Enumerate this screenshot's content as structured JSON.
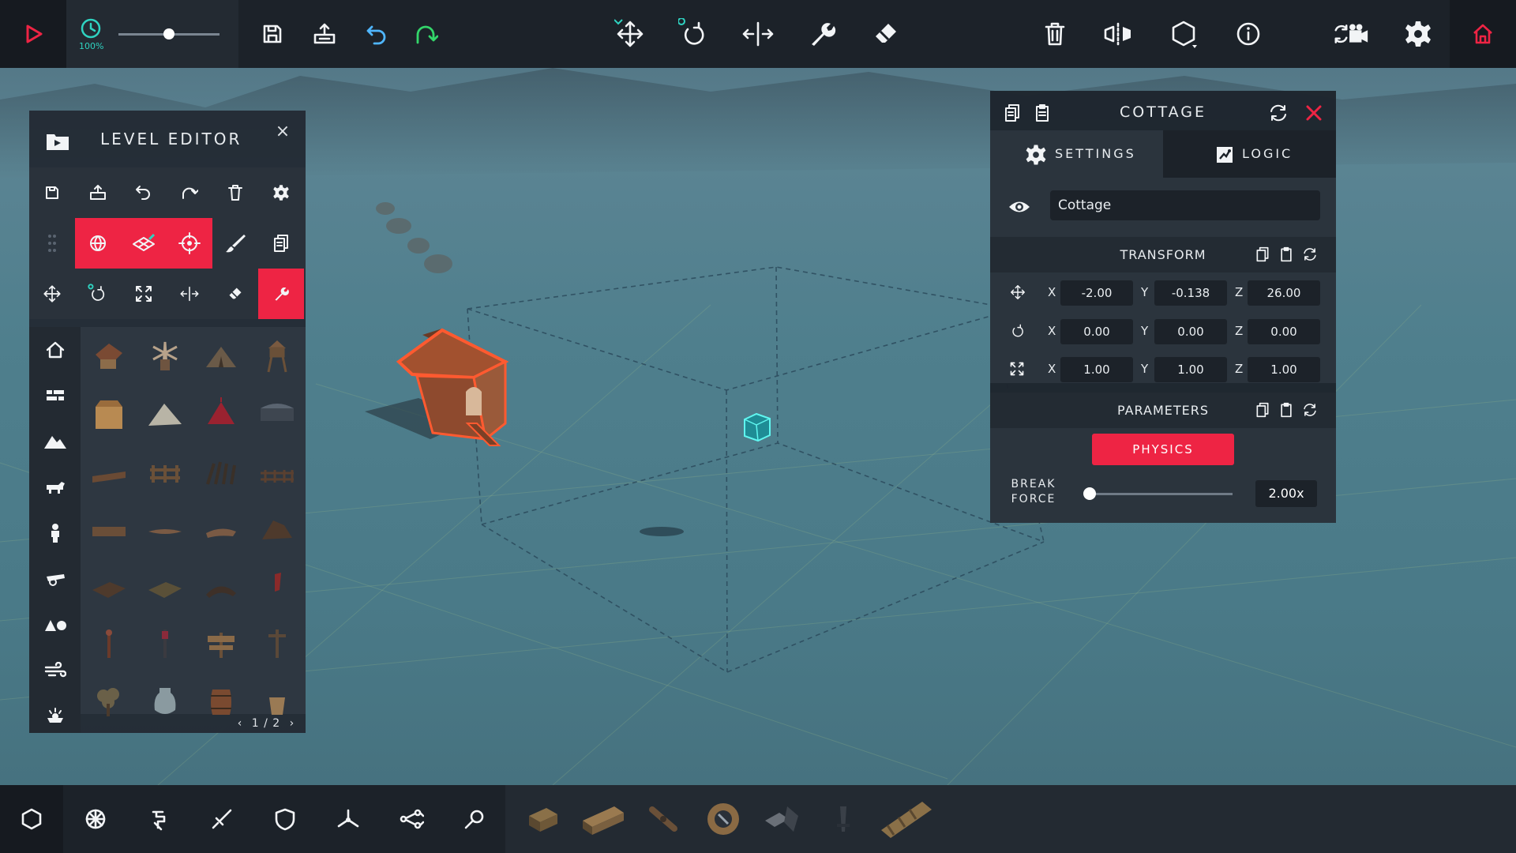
{
  "top_toolbar": {
    "speed_percent": "100%",
    "speed_value": 0.5,
    "accent_color": "#ee2444",
    "teal_color": "#2fd3c1"
  },
  "level_editor": {
    "title": "LEVEL EDITOR",
    "close_label": "×",
    "pagination": "1 / 2"
  },
  "inspector": {
    "title": "COTTAGE",
    "tabs": [
      "SETTINGS",
      "LOGIC"
    ],
    "object_name": "Cottage",
    "transform_title": "TRANSFORM",
    "parameters_title": "PARAMETERS",
    "axis_labels": [
      "X",
      "Y",
      "Z"
    ],
    "position": [
      "-2.00",
      "-0.138",
      "26.00"
    ],
    "rotation": [
      "0.00",
      "0.00",
      "0.00"
    ],
    "scale": [
      "1.00",
      "1.00",
      "1.00"
    ],
    "physics_label": "PHYSICS",
    "break_force_label_1": "BREAK",
    "break_force_label_2": "FORCE",
    "break_force_value": "2.00x",
    "break_force_slider": 0.0
  }
}
